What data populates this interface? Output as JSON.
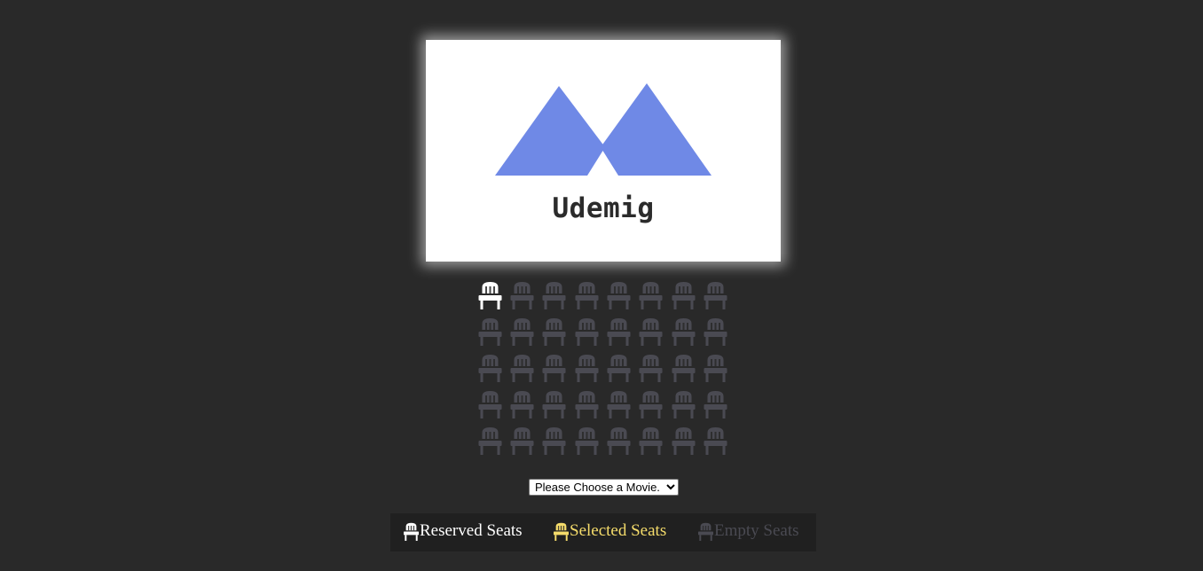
{
  "poster": {
    "brand_text": "Udemig",
    "logo_color": "#6f89e6"
  },
  "seats": {
    "rows": 5,
    "columns": 8,
    "states": [
      [
        "reserved",
        "empty",
        "empty",
        "empty",
        "empty",
        "empty",
        "empty",
        "empty"
      ],
      [
        "empty",
        "empty",
        "empty",
        "empty",
        "empty",
        "empty",
        "empty",
        "empty"
      ],
      [
        "empty",
        "empty",
        "empty",
        "empty",
        "empty",
        "empty",
        "empty",
        "empty"
      ],
      [
        "empty",
        "empty",
        "empty",
        "empty",
        "empty",
        "empty",
        "empty",
        "empty"
      ],
      [
        "empty",
        "empty",
        "empty",
        "empty",
        "empty",
        "empty",
        "empty",
        "empty"
      ]
    ],
    "icon": "chair-icon"
  },
  "movie_select": {
    "selected": "Please Choose a Movie."
  },
  "legend": {
    "reserved_label": "Reserved Seats",
    "selected_label": "Selected Seats",
    "empty_label": "Empty Seats"
  },
  "colors": {
    "background": "#292929",
    "legend_background": "#202020",
    "reserved": "#ffffff",
    "selected": "#f5dc6b",
    "empty": "#4a4a52"
  }
}
